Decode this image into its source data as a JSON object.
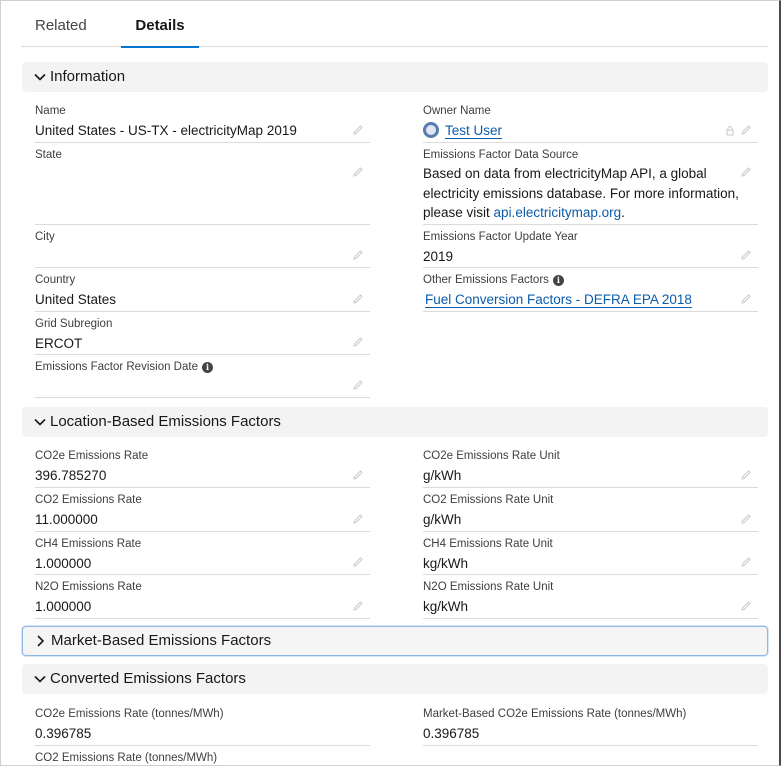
{
  "tabs": {
    "related": "Related",
    "details": "Details"
  },
  "sections": {
    "information": "Information",
    "location": "Location-Based Emissions Factors",
    "market": "Market-Based Emissions Factors",
    "converted": "Converted Emissions Factors"
  },
  "information": {
    "name": {
      "label": "Name",
      "value": "United States - US-TX - electricityMap 2019"
    },
    "owner": {
      "label": "Owner Name",
      "value": "Test User"
    },
    "state": {
      "label": "State",
      "value": ""
    },
    "source": {
      "label": "Emissions Factor Data Source",
      "value_prefix": "Based on data from electricityMap API, a global electricity emissions database. For more information, please visit ",
      "link": "api.electricitymap.org",
      "value_suffix": "."
    },
    "city": {
      "label": "City",
      "value": ""
    },
    "update_year": {
      "label": "Emissions Factor Update Year",
      "value": "2019"
    },
    "country": {
      "label": "Country",
      "value": "United States"
    },
    "other_factors": {
      "label": "Other Emissions Factors",
      "value": "Fuel Conversion Factors - DEFRA EPA 2018"
    },
    "grid": {
      "label": "Grid Subregion",
      "value": "ERCOT"
    },
    "revision_date": {
      "label": "Emissions Factor Revision Date",
      "value": ""
    }
  },
  "location": {
    "co2e_rate": {
      "label": "CO2e Emissions Rate",
      "value": "396.785270"
    },
    "co2e_unit": {
      "label": "CO2e Emissions Rate Unit",
      "value": "g/kWh"
    },
    "co2_rate": {
      "label": "CO2 Emissions Rate",
      "value": "11.000000"
    },
    "co2_unit": {
      "label": "CO2 Emissions Rate Unit",
      "value": "g/kWh"
    },
    "ch4_rate": {
      "label": "CH4 Emissions Rate",
      "value": "1.000000"
    },
    "ch4_unit": {
      "label": "CH4 Emissions Rate Unit",
      "value": "kg/kWh"
    },
    "n2o_rate": {
      "label": "N2O Emissions Rate",
      "value": "1.000000"
    },
    "n2o_unit": {
      "label": "N2O Emissions Rate Unit",
      "value": "kg/kWh"
    }
  },
  "converted": {
    "co2e_tonnes": {
      "label": "CO2e Emissions Rate (tonnes/MWh)",
      "value": "0.396785"
    },
    "market_co2e_tonnes": {
      "label": "Market-Based CO2e Emissions Rate (tonnes/MWh)",
      "value": "0.396785"
    },
    "co2_tonnes": {
      "label": "CO2 Emissions Rate (tonnes/MWh)",
      "value": ""
    }
  },
  "icons": {
    "edit": "pencil-icon",
    "lock": "lock-icon",
    "info": "info-icon",
    "expand": "chevron-down-icon",
    "collapse": "chevron-right-icon"
  },
  "colors": {
    "accent": "#0176d3",
    "link": "#0b5cab",
    "section_bg": "#f3f3f3"
  }
}
